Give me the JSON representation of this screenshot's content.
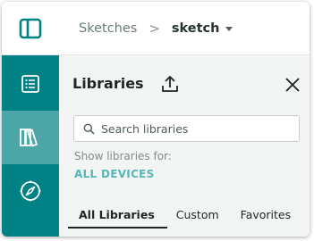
{
  "breadcrumb": {
    "root": "Sketches",
    "separator": ">",
    "current": "sketch"
  },
  "sidebar": {
    "items": [
      {
        "name": "sketchbook",
        "icon": "list-icon",
        "active": false
      },
      {
        "name": "libraries",
        "icon": "books-icon",
        "active": true
      },
      {
        "name": "examples",
        "icon": "compass-icon",
        "active": false
      }
    ]
  },
  "panel": {
    "title": "Libraries",
    "search": {
      "placeholder": "Search libraries",
      "value": ""
    },
    "filter_label": "Show libraries for:",
    "filter_value": "ALL DEVICES",
    "tabs": [
      "All Libraries",
      "Custom",
      "Favorites"
    ],
    "active_tab": "All Libraries"
  },
  "colors": {
    "teal": "#008184",
    "teal_active": "#4ca6a8",
    "link": "#56b5b7"
  }
}
